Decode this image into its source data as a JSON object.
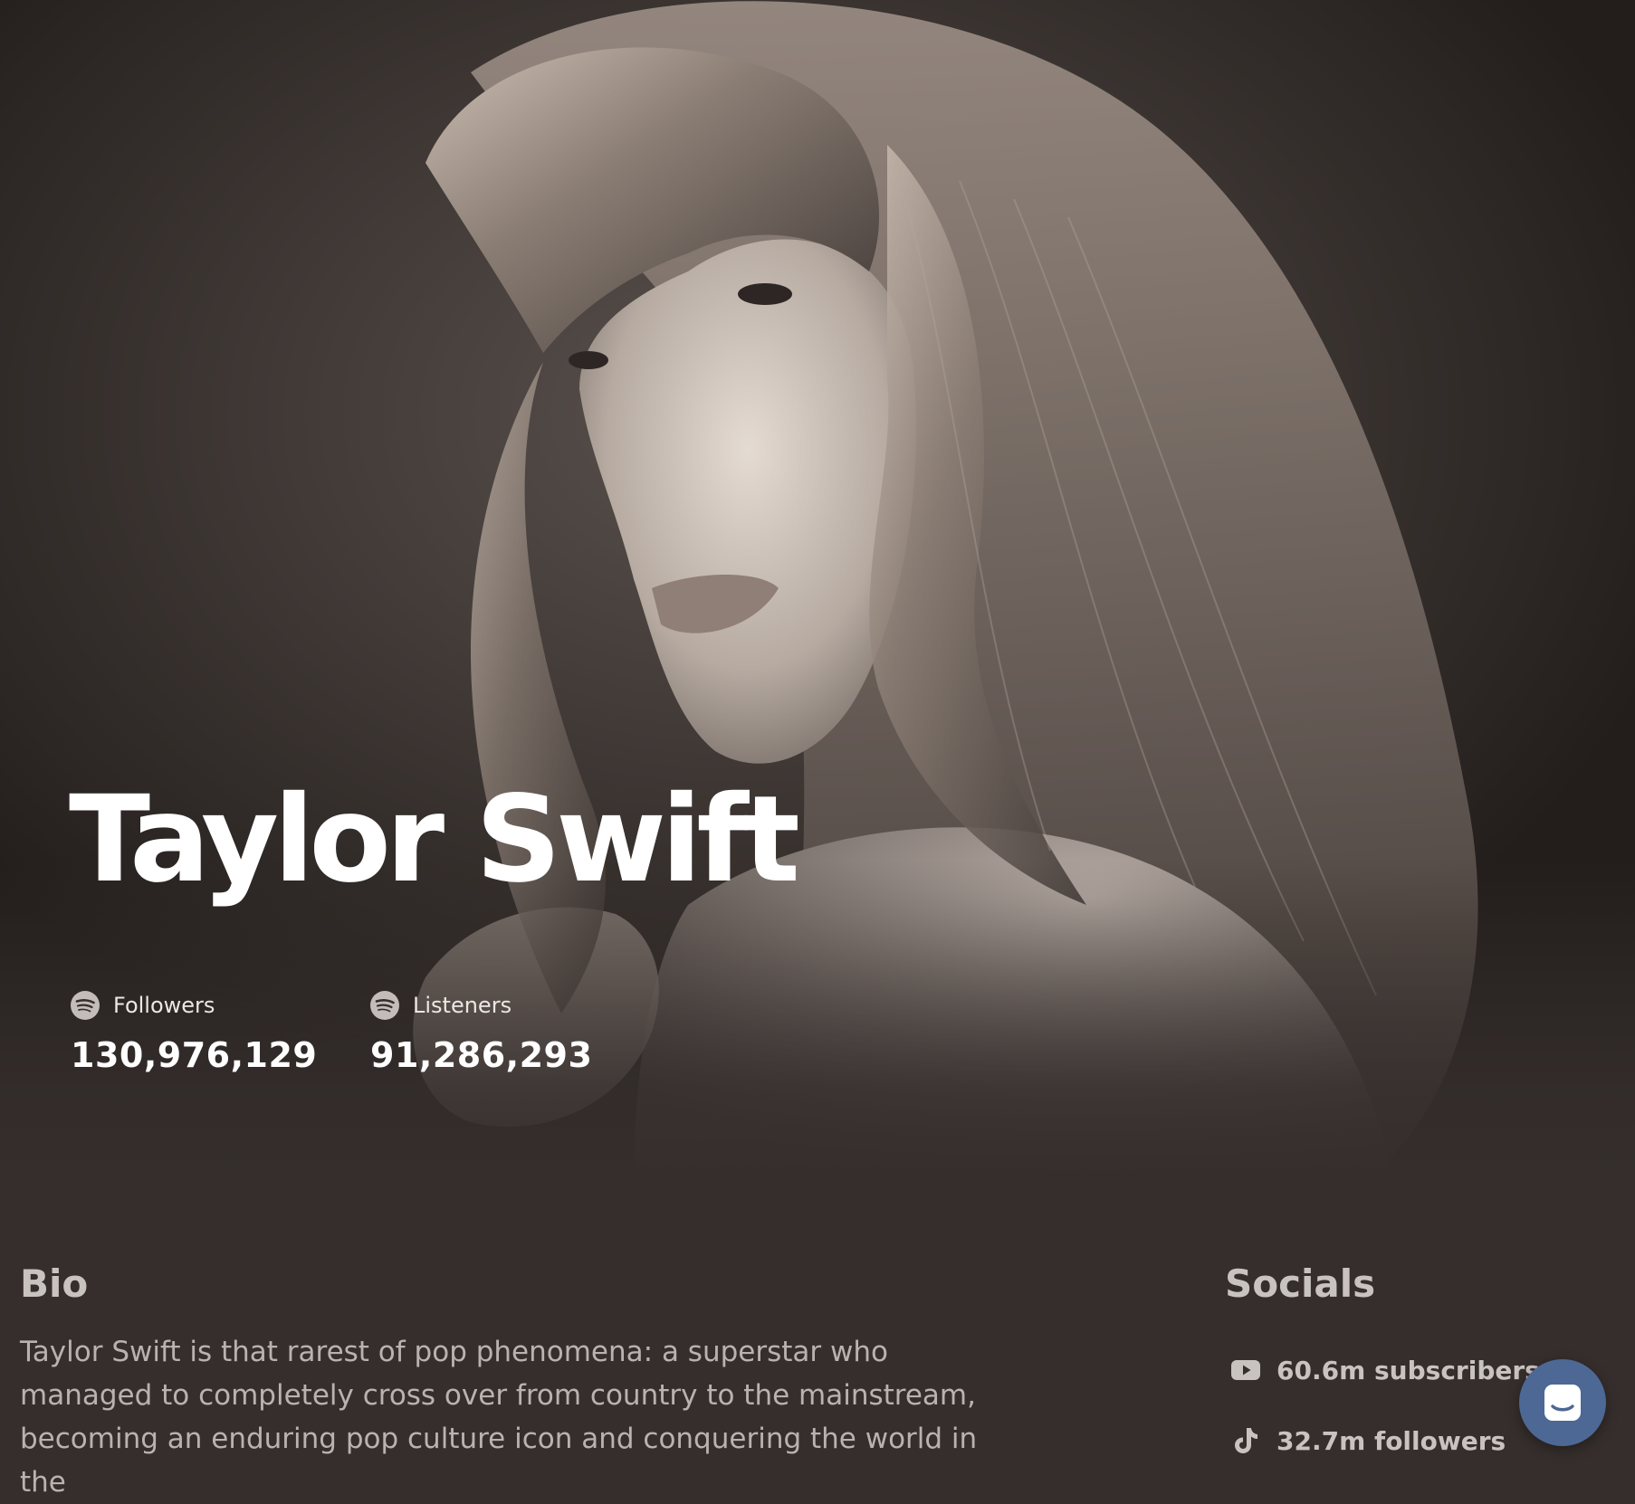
{
  "artist": {
    "name": "Taylor Swift"
  },
  "stats": [
    {
      "label": "Followers",
      "value": "130,976,129",
      "icon": "spotify-icon"
    },
    {
      "label": "Listeners",
      "value": "91,286,293",
      "icon": "spotify-icon"
    }
  ],
  "bio": {
    "title": "Bio",
    "text": "Taylor Swift is that rarest of pop phenomena: a superstar who managed to completely cross over from country to the mainstream, becoming an enduring pop culture icon and conquering the world in the"
  },
  "socials": {
    "title": "Socials",
    "items": [
      {
        "icon": "youtube-icon",
        "text": "60.6m subscribers"
      },
      {
        "icon": "tiktok-icon",
        "text": "32.7m followers"
      }
    ]
  },
  "chat": {
    "icon": "chat-icon"
  },
  "colors": {
    "background": "#352e2c",
    "chat_button": "#4d6894",
    "title_text": "#ffffff",
    "muted_text": "#c9c3c0"
  }
}
